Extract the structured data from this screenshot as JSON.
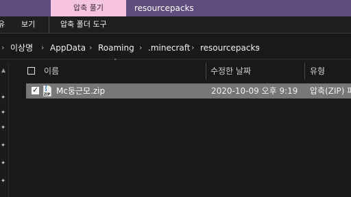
{
  "titlebar": {
    "context_tab": "압축 풀기",
    "title": "resourcepacks"
  },
  "ribbon": {
    "items": [
      "유",
      "보기",
      "압축 폴더 도구"
    ]
  },
  "address": {
    "crumbs": [
      "이상명",
      "AppData",
      "Roaming",
      ".minecraft",
      "resourcepacks"
    ]
  },
  "columns": {
    "name": "이름",
    "date": "수정한 날짜",
    "type": "유형"
  },
  "files": [
    {
      "name": "Mc둥근모.zip",
      "date": "2020-10-09 오후 9:19",
      "type": "압축(ZIP) 파",
      "selected": true,
      "checked": true
    }
  ],
  "colors": {
    "titlebar": "#5f4c7c",
    "context_tab": "#f6c3e0",
    "selected_row": "#777777",
    "background": "#191919"
  },
  "icons": {
    "zip": "zip-folder-icon",
    "pin": "pin-icon",
    "checkbox": "checkbox-icon"
  }
}
